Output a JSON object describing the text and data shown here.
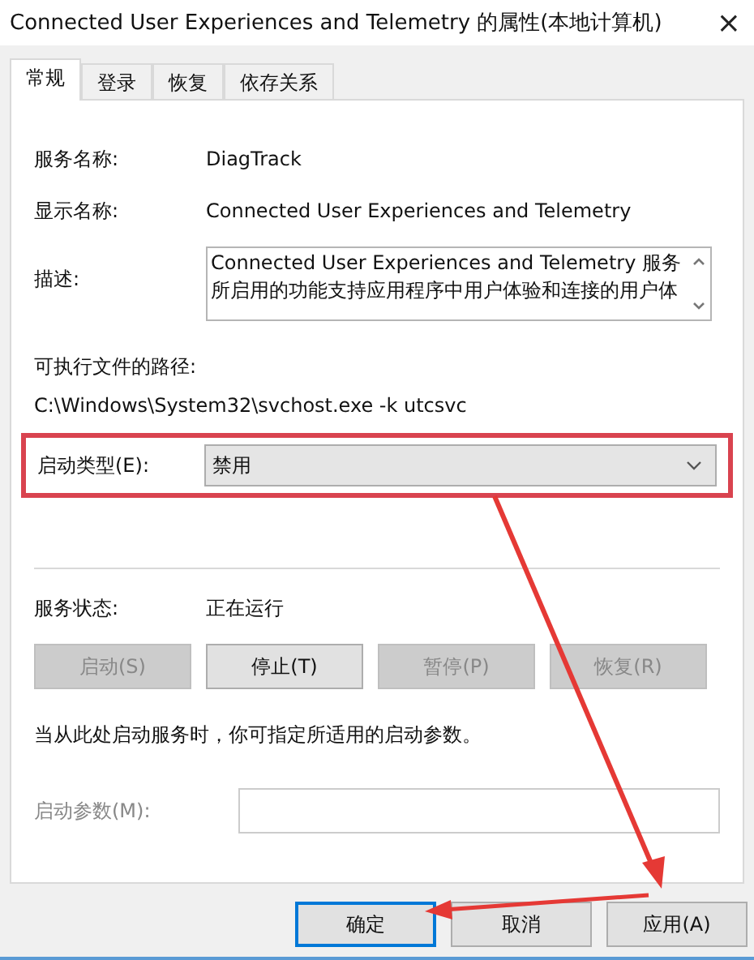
{
  "window": {
    "title": "Connected User Experiences and Telemetry 的属性(本地计算机)",
    "close": "×"
  },
  "tabs": [
    {
      "label": "常规",
      "selected": true
    },
    {
      "label": "登录",
      "selected": false
    },
    {
      "label": "恢复",
      "selected": false
    },
    {
      "label": "依存关系",
      "selected": false
    }
  ],
  "fields": [
    {
      "label": "服务名称:",
      "value": "DiagTrack"
    },
    {
      "label": "显示名称:",
      "value": "Connected User Experiences and Telemetry"
    }
  ],
  "description": {
    "label": "描述:",
    "text": "Connected User Experiences and Telemetry 服务所启用的功能支持应用程序中用户体验和连接的用户体"
  },
  "path": {
    "label": "可执行文件的路径:",
    "value": "C:\\Windows\\System32\\svchost.exe -k utcsvc"
  },
  "startup_type": {
    "label": "启动类型(E):",
    "value": "禁用",
    "highlighted": true
  },
  "service_status": {
    "label": "服务状态:",
    "value": "正在运行"
  },
  "service_buttons": [
    {
      "label": "启动(S)",
      "disabled": true
    },
    {
      "label": "停止(T)",
      "disabled": false
    },
    {
      "label": "暂停(P)",
      "disabled": true
    },
    {
      "label": "恢复(R)",
      "disabled": true
    }
  ],
  "hint": "当从此处启动服务时，你可指定所适用的启动参数。",
  "start_params": {
    "label": "启动参数(M):",
    "disabled": true
  },
  "dialog_buttons": [
    {
      "label": "确定",
      "selected": true
    },
    {
      "label": "取消",
      "selected": false
    },
    {
      "label": "应用(A)",
      "selected": false
    }
  ]
}
